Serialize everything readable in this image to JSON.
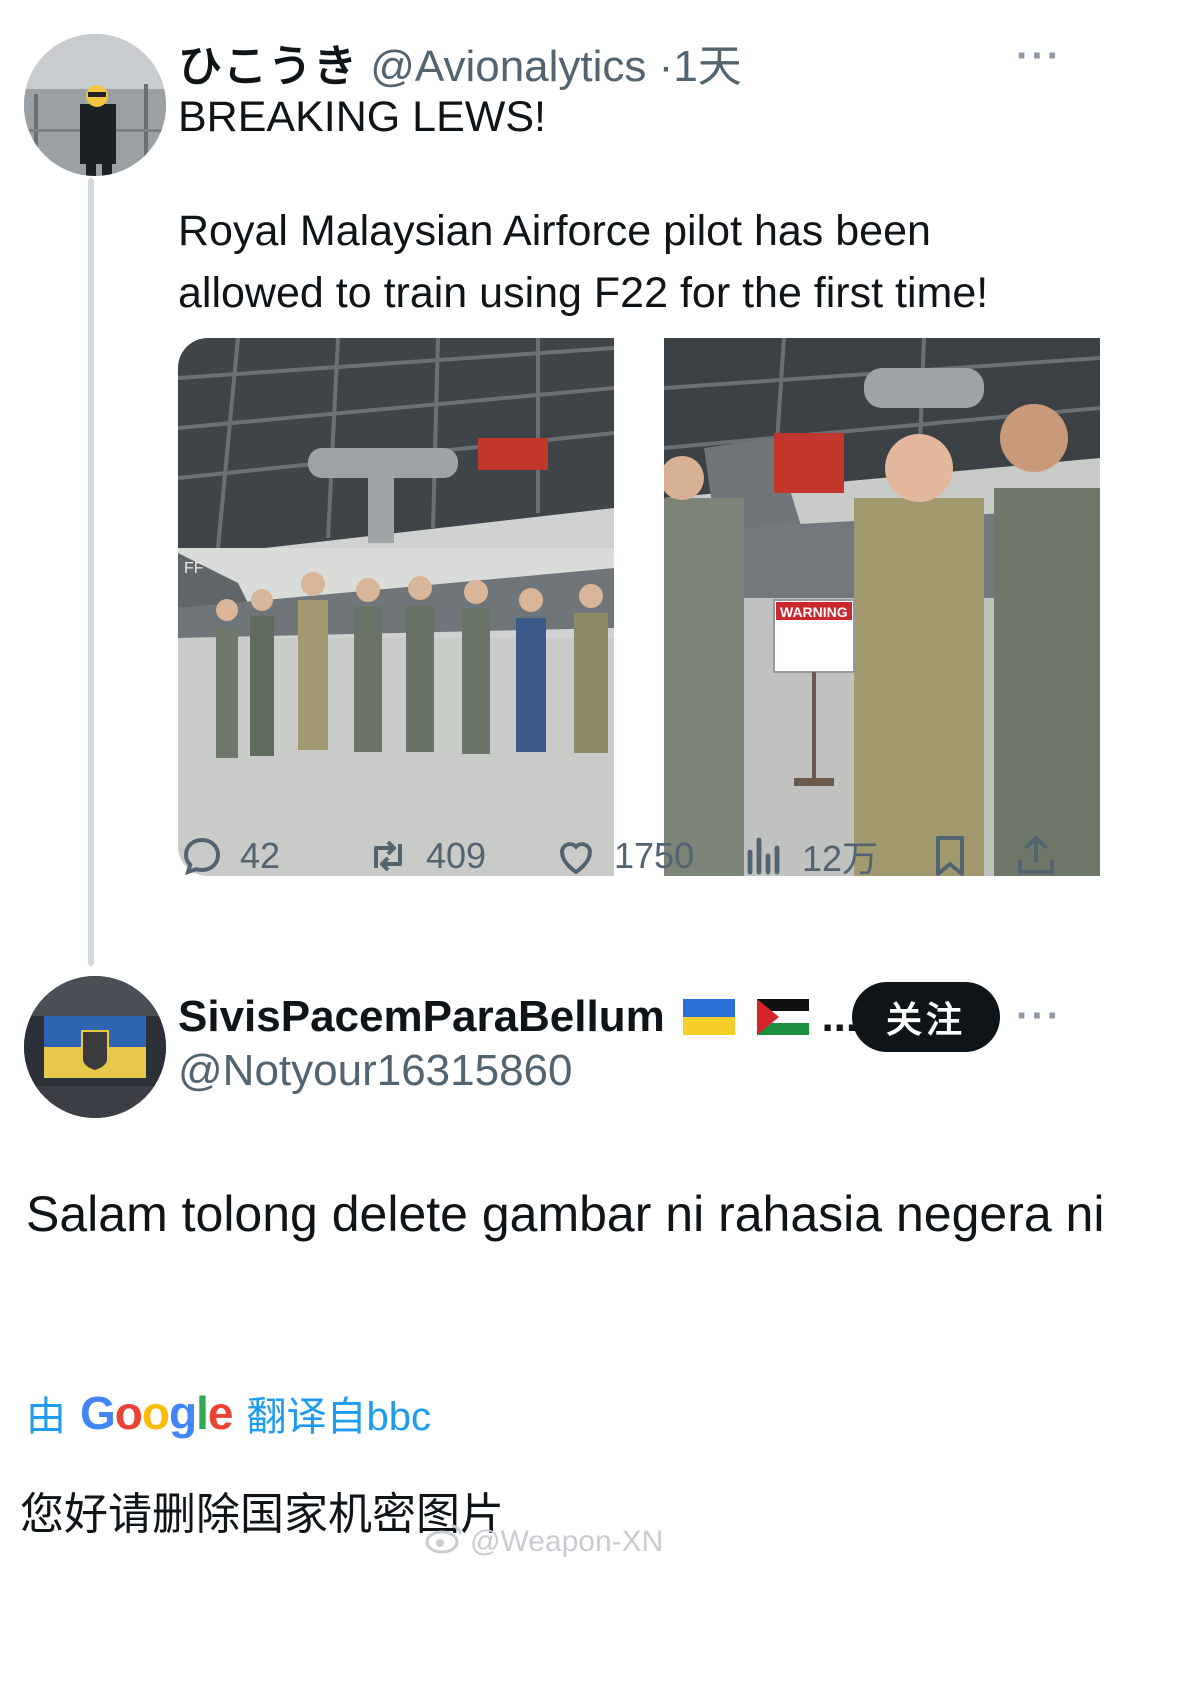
{
  "tweet": {
    "display_name": "ひこうき",
    "handle": "@Avionalytics",
    "separator": "·",
    "time": "1天",
    "more": "···",
    "text_line1": "BREAKING LEWS!",
    "text_body": "Royal Malaysian Airforce pilot has been\nallowed to train using F22 for the first time!",
    "photo_left_tail": "FF",
    "photo_right_sign": "WARNING",
    "actions": {
      "replies": "42",
      "retweets": "409",
      "likes": "1750",
      "views": "12万"
    }
  },
  "reply": {
    "display_name": "SivisPacemParaBellum",
    "name_suffix": "...",
    "handle": "@Notyour16315860",
    "follow_label": "关注",
    "more": "···",
    "text": "Salam tolong delete gambar ni rahasia negera ni",
    "translate_prefix": "由",
    "translate_brand": "Google",
    "translate_suffix": "翻译自bbc",
    "translated_text": "您好请删除国家机密图片"
  },
  "watermark": "@Weapon-XN",
  "colors": {
    "accent": "#1d9bf0",
    "secondary_text": "#536471",
    "thread_line": "#cfd9de",
    "follow_bg": "#0f1419"
  }
}
